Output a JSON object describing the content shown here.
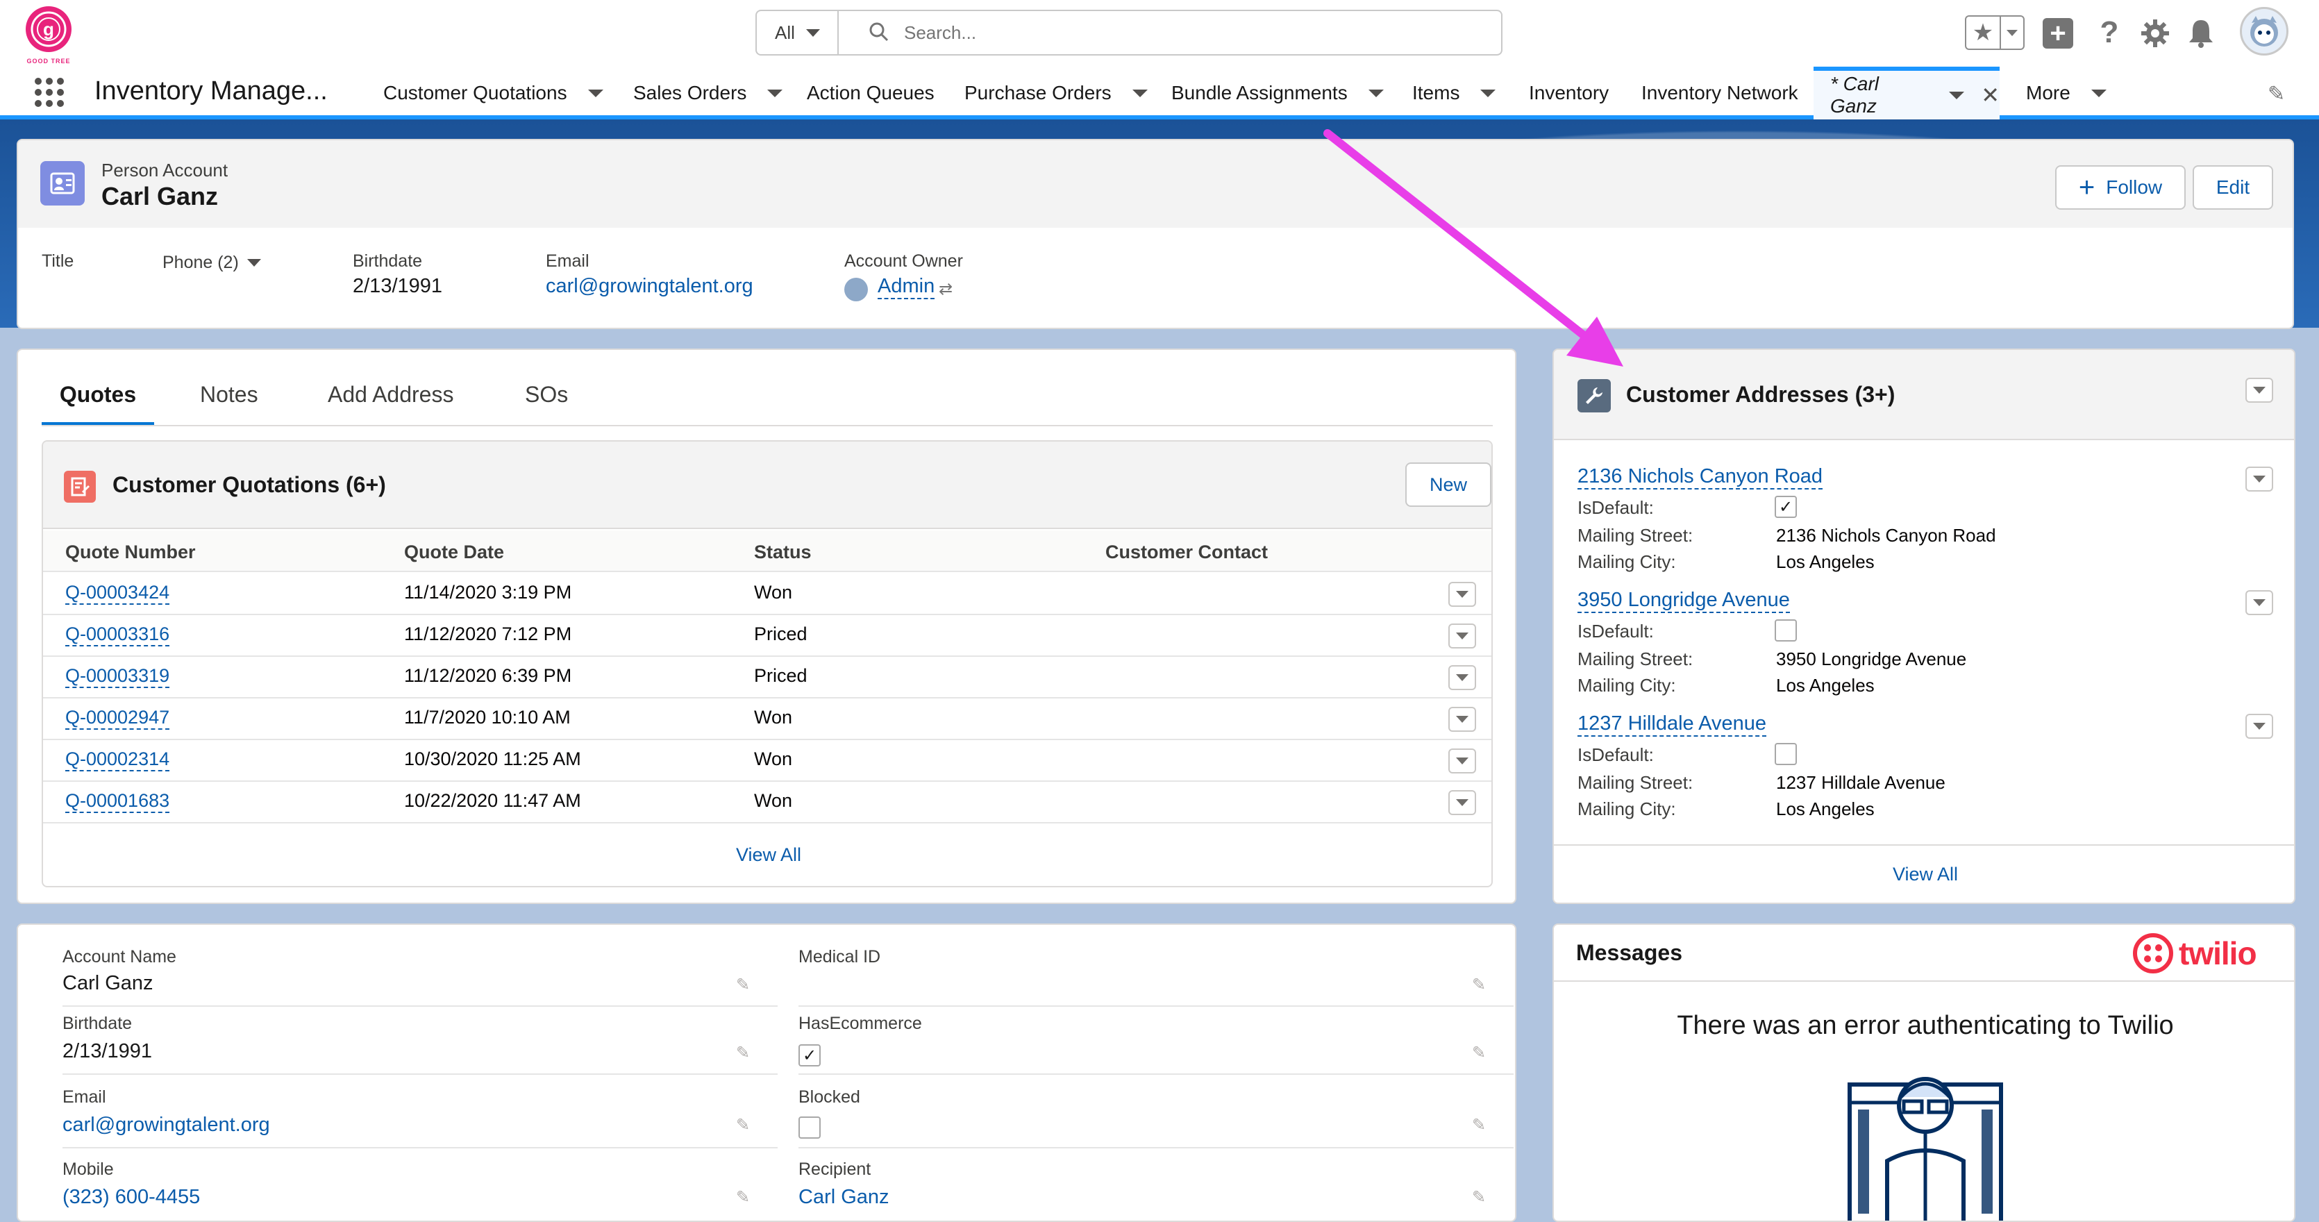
{
  "header": {
    "logo_text": "GOOD TREE",
    "search_scope": "All",
    "search_placeholder": "Search..."
  },
  "nav": {
    "app_name": "Inventory Manage...",
    "items": [
      {
        "label": "Customer Quotations",
        "dropdown": true
      },
      {
        "label": "Sales Orders",
        "dropdown": true
      },
      {
        "label": "Action Queues",
        "dropdown": false
      },
      {
        "label": "Purchase Orders",
        "dropdown": true
      },
      {
        "label": "Bundle Assignments",
        "dropdown": true
      },
      {
        "label": "Items",
        "dropdown": true
      },
      {
        "label": "Inventory",
        "dropdown": false
      },
      {
        "label": "Inventory Network",
        "dropdown": false
      }
    ],
    "active_tab": "* Carl Ganz",
    "more": "More"
  },
  "record": {
    "object_type": "Person Account",
    "name": "Carl Ganz",
    "follow_label": "Follow",
    "edit_label": "Edit",
    "fields": {
      "title_label": "Title",
      "phone_label": "Phone (2)",
      "birthdate_label": "Birthdate",
      "birthdate_value": "2/13/1991",
      "email_label": "Email",
      "email_value": "carl@growingtalent.org",
      "owner_label": "Account Owner",
      "owner_value": "Admin"
    }
  },
  "tabs": [
    "Quotes",
    "Notes",
    "Add Address",
    "SOs"
  ],
  "quotations": {
    "title": "Customer Quotations (6+)",
    "new_label": "New",
    "columns": [
      "Quote Number",
      "Quote Date",
      "Status",
      "Customer Contact"
    ],
    "rows": [
      {
        "number": "Q-00003424",
        "date": "11/14/2020 3:19 PM",
        "status": "Won",
        "contact": ""
      },
      {
        "number": "Q-00003316",
        "date": "11/12/2020 7:12 PM",
        "status": "Priced",
        "contact": ""
      },
      {
        "number": "Q-00003319",
        "date": "11/12/2020 6:39 PM",
        "status": "Priced",
        "contact": ""
      },
      {
        "number": "Q-00002947",
        "date": "11/7/2020 10:10 AM",
        "status": "Won",
        "contact": ""
      },
      {
        "number": "Q-00002314",
        "date": "10/30/2020 11:25 AM",
        "status": "Won",
        "contact": ""
      },
      {
        "number": "Q-00001683",
        "date": "10/22/2020 11:47 AM",
        "status": "Won",
        "contact": ""
      }
    ],
    "view_all": "View All"
  },
  "addresses": {
    "title": "Customer Addresses (3+)",
    "labels": {
      "is_default": "IsDefault:",
      "street": "Mailing Street:",
      "city": "Mailing City:"
    },
    "items": [
      {
        "name": "2136 Nichols Canyon Road",
        "is_default": true,
        "street": "2136 Nichols Canyon Road",
        "city": "Los Angeles"
      },
      {
        "name": "3950 Longridge Avenue",
        "is_default": false,
        "street": "3950 Longridge Avenue",
        "city": "Los Angeles"
      },
      {
        "name": "1237 Hilldale Avenue",
        "is_default": false,
        "street": "1237 Hilldale Avenue",
        "city": "Los Angeles"
      }
    ],
    "view_all": "View All"
  },
  "details": {
    "left": [
      {
        "label": "Account Name",
        "value": "Carl Ganz",
        "link": false
      },
      {
        "label": "Birthdate",
        "value": "2/13/1991",
        "link": false
      },
      {
        "label": "Email",
        "value": "carl@growingtalent.org",
        "link": true
      },
      {
        "label": "Mobile",
        "value": "(323) 600-4455",
        "link": true
      }
    ],
    "right": [
      {
        "label": "Medical ID",
        "value": "",
        "type": "text"
      },
      {
        "label": "HasEcommerce",
        "checked": true,
        "type": "checkbox"
      },
      {
        "label": "Blocked",
        "checked": false,
        "type": "checkbox"
      },
      {
        "label": "Recipient",
        "value": "Carl Ganz",
        "type": "link"
      }
    ]
  },
  "messages": {
    "title": "Messages",
    "brand": "twilio",
    "error": "There was an error authenticating to Twilio"
  },
  "colors": {
    "link": "#0b5cab",
    "arrow": "#e83ee8",
    "twilio": "#f22f46",
    "brand_pink": "#e8247c"
  }
}
